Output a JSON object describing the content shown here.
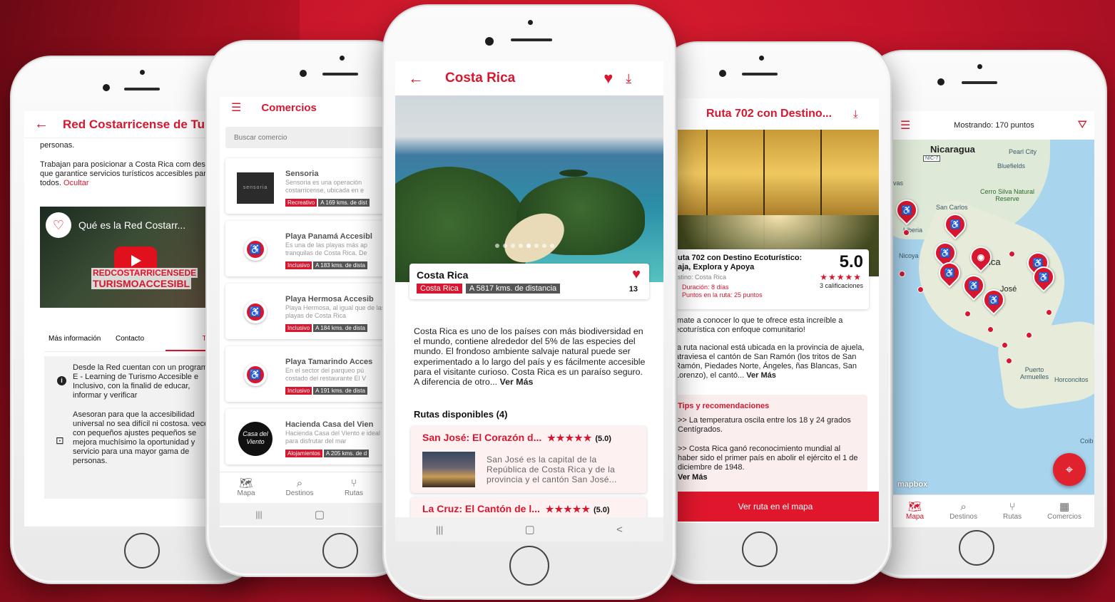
{
  "colors": {
    "accent": "#d6172f",
    "background": "#c8162a"
  },
  "phone1": {
    "title": "Red Costarricense de Tu",
    "para1": "personas.",
    "para2": "Trabajan para posicionar a Costa Rica com destino que garantice servicios turísticos accesibles para todos.",
    "hide_link": "Ocultar",
    "video_title": "Qué es la Red Costarr...",
    "video_brand1": "REDCOSTARRICENSEDE",
    "video_brand2": "TURISMOACCESIBL",
    "tabs": [
      "Más información",
      "Contacto",
      "Tips"
    ],
    "tip1": "Desde la Red cuentan con un programa E - Learning de Turismo Accesible e Inclusivo, con la finalid de educar, informar y verificar",
    "tip2": "Asesoran para que la accesibilidad universal no sea difícil ni costosa. veces con pequeños ajustes pequeños se mejora muchísimo la oportunidad y servicio para una mayor gama de personas."
  },
  "phone2": {
    "title": "Comercios",
    "search_placeholder": "Buscar comercio",
    "items": [
      {
        "name": "Sensoria",
        "desc": "Sensoria es una operación costarricense, ubicada en e",
        "tag": "Recreativo",
        "dist": "A 169 kms. de dist",
        "logo": "sensoria"
      },
      {
        "name": "Playa Panamá Accesibl",
        "desc": "Es una de las playas más ap tranquilas de Costa Rica. De",
        "tag": "Inclusivo",
        "dist": "A 183 kms. de dista"
      },
      {
        "name": "Playa Hermosa Accesib",
        "desc": "Playa Hermosa, al igual que de las playas de Costa Rica",
        "tag": "Inclusivo",
        "dist": "A 184 kms. de dista"
      },
      {
        "name": "Playa Tamarindo Acces",
        "desc": "En el sector del parqueo pú costado del restaurante El V",
        "tag": "Inclusivo",
        "dist": "A 191 kms. de dista"
      },
      {
        "name": "Hacienda Casa del Vien",
        "desc": "Hacienda Casa del Viento e ideal para disfrutar del mar",
        "tag": "Alojamientos",
        "dist": "A 205 kms. de d",
        "logo": "Casa del Viento"
      }
    ],
    "nav": [
      "Mapa",
      "Destinos",
      "Rutas"
    ],
    "sys": [
      "|||",
      "▢"
    ]
  },
  "phone3": {
    "title": "Costa Rica",
    "card_title": "Costa Rica",
    "tag": "Costa Rica",
    "distance": "A 5817 kms. de distancia",
    "likes": "13",
    "description": "Costa Rica es uno de los países con más biodiversidad en el mundo, contiene alrededor del 5% de las especies del mundo. El frondoso ambiente salvaje natural puede ser experimentado a lo largo del país y es fácilmente accesible para el visitante curioso. Costa Rica es un paraíso seguro. A diferencia de otro...",
    "more": "Ver Más",
    "routes_header": "Rutas disponibles (4)",
    "route1_title": "San José: El Corazón d...",
    "route1_rating": "(5.0)",
    "route1_desc": "San José es la capital de la República de Costa Rica y de la provincia y el cantón San José...",
    "route2_title": "La Cruz: El Cantón de l...",
    "route2_rating": "(5.0)",
    "stars": "★★★★★",
    "sys": [
      "|||",
      "▢",
      "<"
    ]
  },
  "phone4": {
    "title": "Ruta 702 con Destino...",
    "card_title": "uta 702 con Destino Ecoturístico: aja, Explora y Apoya",
    "destino": "stino: Costa Rica",
    "duracion": "Duración: 8 días",
    "puntos": "Puntos en la ruta: 25 puntos",
    "rating": "5.0",
    "stars": "★★★★★",
    "calif": "3 calificaciones",
    "desc1": "ímate a conocer lo que te ofrece esta increíble a ecoturística con enfoque comunitario!",
    "desc2": "ta ruta nacional está ubicada en la provincia de ajuela, atraviesa el cantón de San Ramón (los tritos de San Ramón, Piedades Norte, Ángeles, ñas Blancas, San Lorenzo), el cantó...",
    "more": "Ver Más",
    "tips_header": "Tips y recomendaciones",
    "tip1": ">> La temperatura oscila entre los 18 y 24 grados Centígrados.",
    "tip2": ">> Costa Rica ganó reconocimiento mundial al haber sido el primer país en abolir el ejército el 1 de diciembre de 1948.",
    "tip_more": "Ver Más",
    "button": "Ver ruta en el mapa"
  },
  "phone5": {
    "header": "Mostrando: 170 puntos",
    "labels": {
      "nicaragua": "Nicaragua",
      "nic7": "NIC-7",
      "pearl": "Pearl City",
      "bluefields": "Bluefields",
      "cerro": "Cerro Silva Natural Reserve",
      "sancarlos": "San Carlos",
      "liberia": "Liberia",
      "nicoya": "Nicoya",
      "ica": "ica",
      "jose": "José",
      "puerto": "Puerto Armuelles",
      "horconcitos": "Horconcitos",
      "coiba": "Coib",
      "vas": "vas",
      "mapbox": "mapbox"
    },
    "nav": [
      "Mapa",
      "Destinos",
      "Rutas",
      "Comercios"
    ]
  }
}
